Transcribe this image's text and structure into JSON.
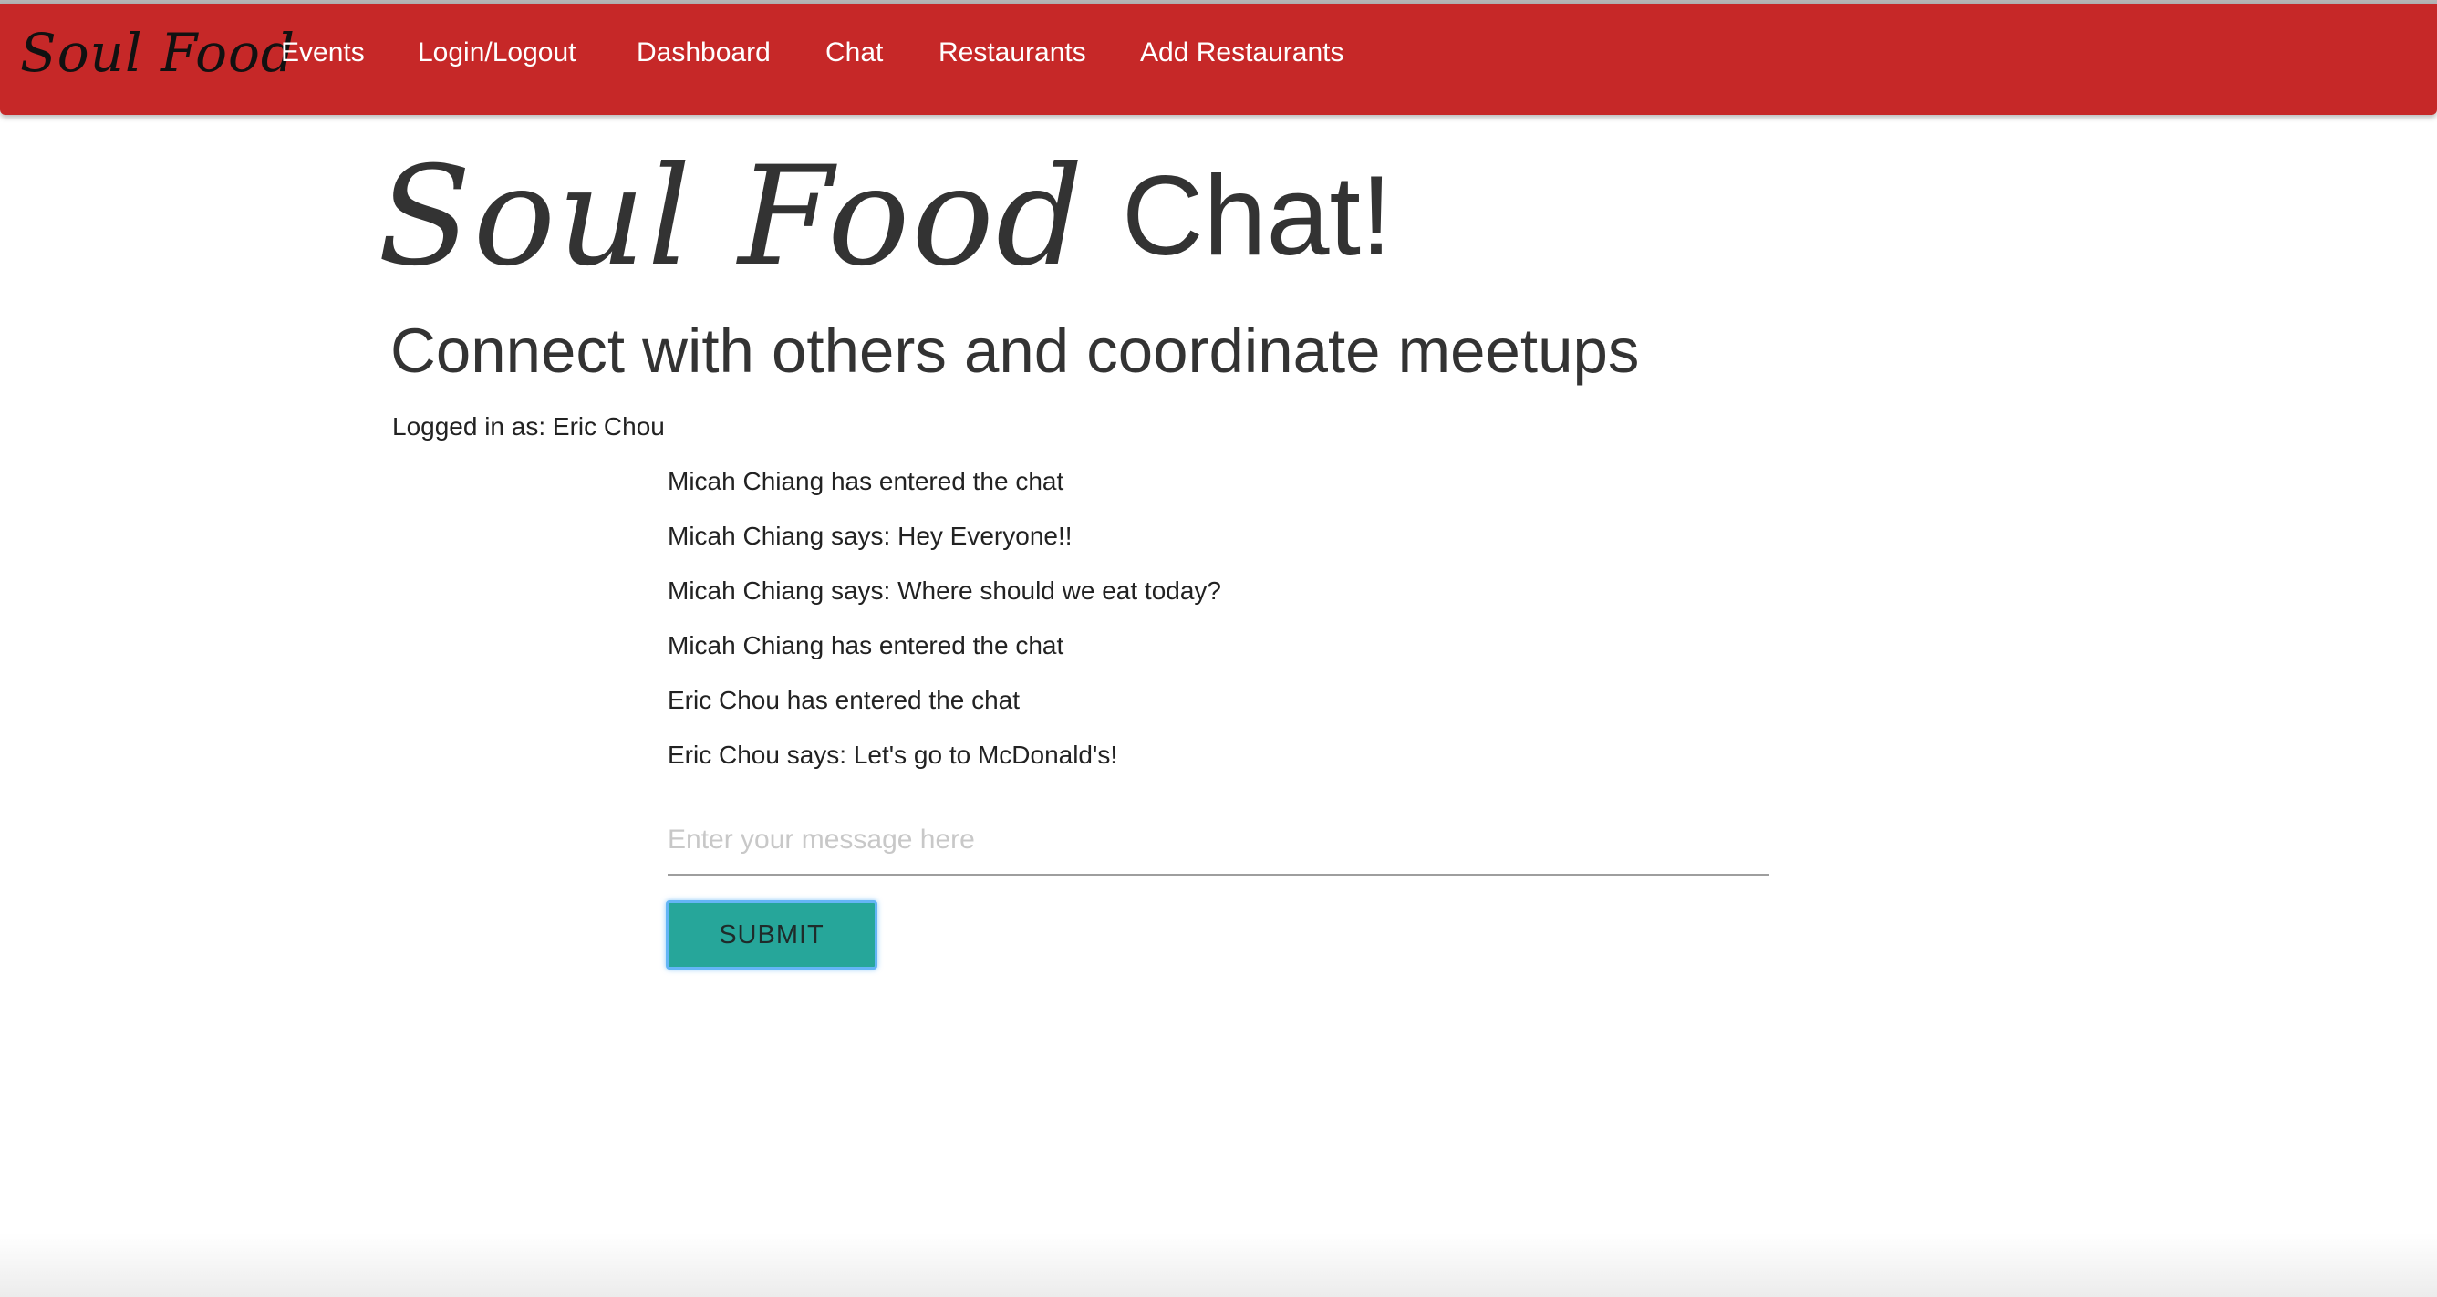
{
  "nav": {
    "brand": "Soul Food",
    "items": [
      {
        "label": "Events"
      },
      {
        "label": "Login/Logout"
      },
      {
        "label": "Dashboard"
      },
      {
        "label": "Chat"
      },
      {
        "label": "Restaurants"
      },
      {
        "label": "Add Restaurants"
      }
    ]
  },
  "hero": {
    "logo_text": "Soul Food",
    "title_suffix": "Chat!"
  },
  "subtitle": "Connect with others and coordinate meetups",
  "user": {
    "logged_in_text": "Logged in as: Eric Chou"
  },
  "chat": {
    "messages": [
      "Micah Chiang has entered the chat",
      "Micah Chiang says: Hey Everyone!!",
      "Micah Chiang says: Where should we eat today?",
      "Micah Chiang has entered the chat",
      "Eric Chou has entered the chat",
      "Eric Chou says: Let's go to McDonald's!"
    ],
    "input": {
      "value": "",
      "placeholder": "Enter your message here"
    },
    "submit_label": "SUBMIT"
  },
  "colors": {
    "navbar": "#c62828",
    "nav_text": "#ffffff",
    "submit_button": "#26a69a",
    "submit_focus_ring": "#64b5f6",
    "body_text": "#333333"
  }
}
